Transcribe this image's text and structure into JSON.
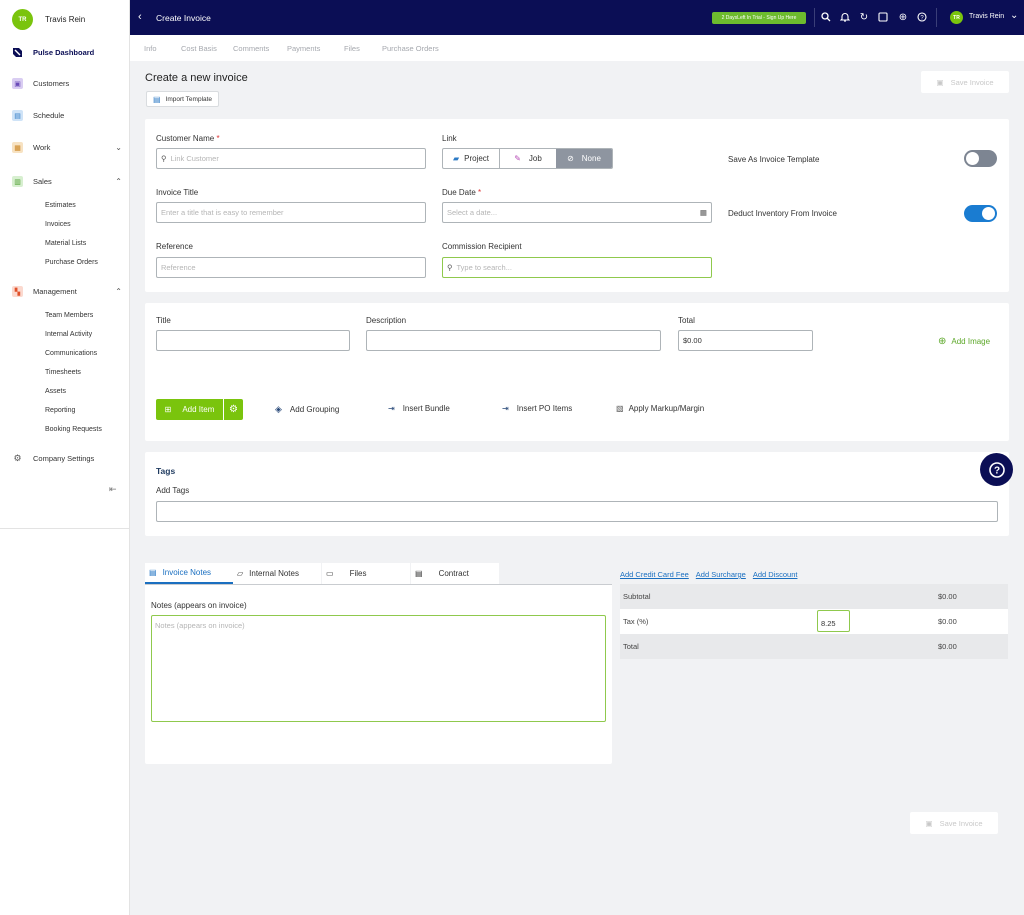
{
  "user": {
    "initials": "TR",
    "name": "Travis Rein"
  },
  "sidebar": {
    "dashboard": "Pulse Dashboard",
    "customers": "Customers",
    "schedule": "Schedule",
    "work": "Work",
    "sales": "Sales",
    "sales_items": [
      "Estimates",
      "Invoices",
      "Material Lists",
      "Purchase Orders"
    ],
    "management": "Management",
    "management_items": [
      "Team Members",
      "Internal Activity",
      "Communications",
      "Timesheets",
      "Assets",
      "Reporting",
      "Booking Requests"
    ],
    "company_settings": "Company Settings"
  },
  "topbar": {
    "title": "Create Invoice",
    "trial": "2 DaysLeft In Trial - Sign Up Here",
    "user_name": "Travis Rein"
  },
  "tabs": [
    "Info",
    "Cost Basis",
    "Comments",
    "Payments",
    "Files",
    "Purchase Orders"
  ],
  "page": {
    "heading": "Create a new invoice",
    "import_template": "Import Template",
    "save_invoice": "Save Invoice"
  },
  "form": {
    "customer_label": "Customer Name",
    "customer_placeholder": "Link Customer",
    "link_label": "Link",
    "link_options": [
      "Project",
      "Job",
      "None"
    ],
    "save_template": "Save As Invoice Template",
    "invoice_title_label": "Invoice Title",
    "invoice_title_placeholder": "Enter a title that is easy to remember",
    "due_date_label": "Due Date",
    "due_date_placeholder": "Select a date...",
    "deduct_inventory": "Deduct Inventory From Invoice",
    "reference_label": "Reference",
    "reference_placeholder": "Reference",
    "commission_label": "Commission Recipient",
    "commission_placeholder": "Type to search...",
    "required_mark": "*",
    "toggles": {
      "save_template": false,
      "deduct_inventory": true
    }
  },
  "items": {
    "title_label": "Title",
    "description_label": "Description",
    "total_label": "Total",
    "total_value": "$0.00",
    "add_image": "Add Image",
    "add_item": "Add Item",
    "add_grouping": "Add Grouping",
    "insert_bundle": "Insert Bundle",
    "insert_po": "Insert PO Items",
    "apply_markup": "Apply Markup/Margin"
  },
  "tags": {
    "heading": "Tags",
    "add_label": "Add Tags"
  },
  "notes": {
    "tabs": [
      "Invoice Notes",
      "Internal Notes",
      "Files",
      "Contract"
    ],
    "label": "Notes (appears on invoice)",
    "placeholder": "Notes (appears on invoice)"
  },
  "summary": {
    "links": [
      "Add Credit Card Fee",
      "Add Surcharge",
      "Add Discount"
    ],
    "subtotal_label": "Subtotal",
    "subtotal": "$0.00",
    "tax_label": "Tax (%)",
    "tax_rate": "8.25",
    "tax": "$0.00",
    "total_label": "Total",
    "total": "$0.00"
  },
  "colors": {
    "nav": "#0b0e55",
    "accent": "#7ac40d",
    "link": "#1a6fc0",
    "toggle_on": "#1a7cd1"
  }
}
